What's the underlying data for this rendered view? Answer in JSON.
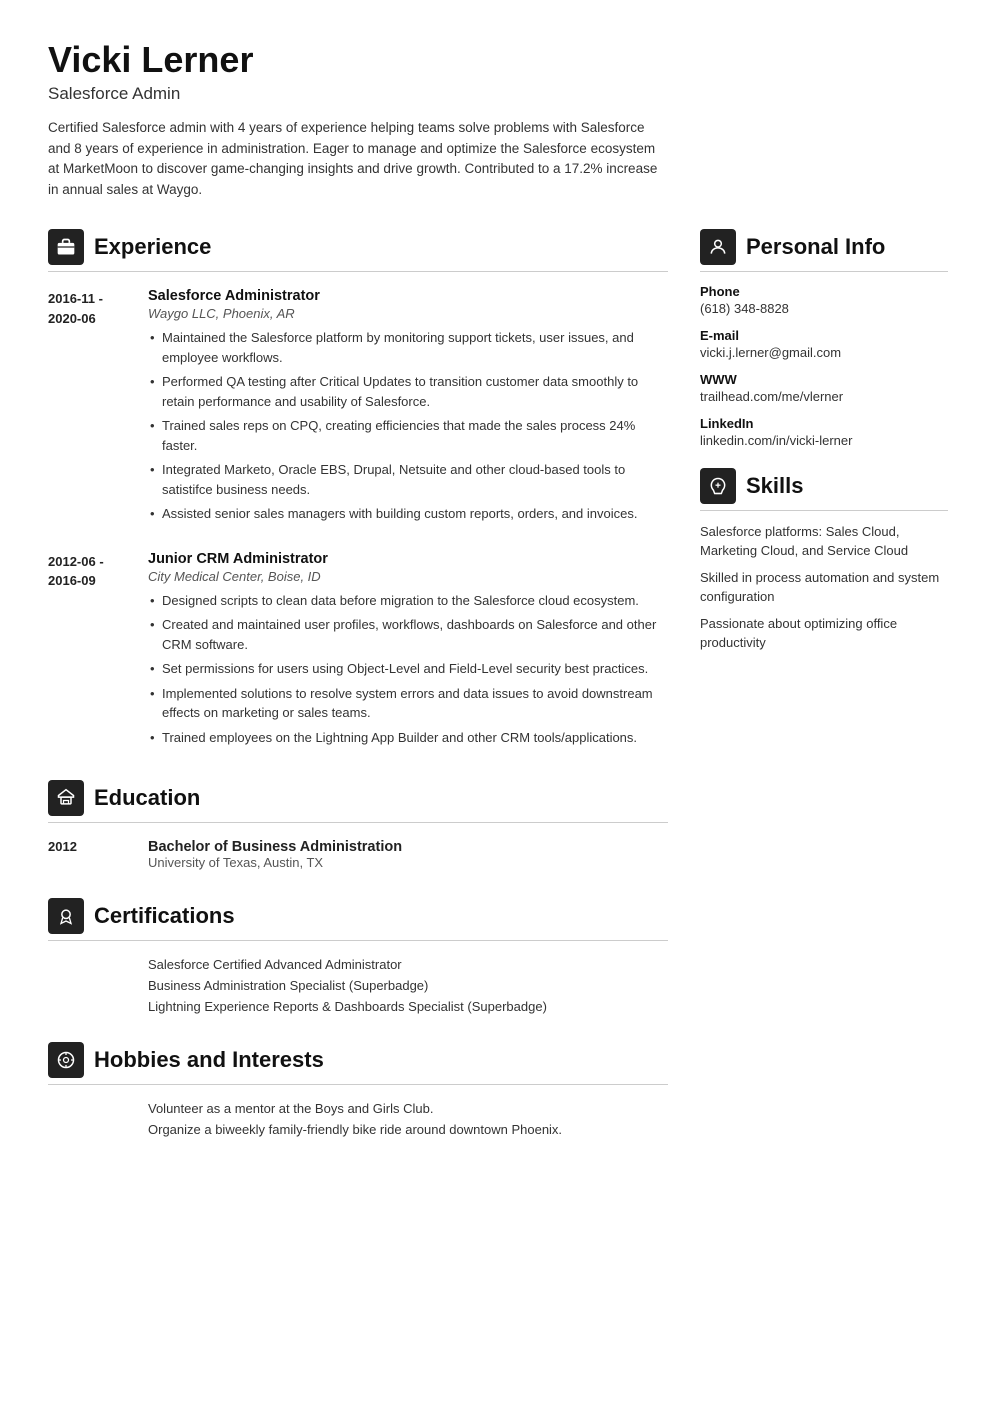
{
  "header": {
    "name": "Vicki Lerner",
    "title": "Salesforce Admin",
    "summary": "Certified Salesforce admin with 4 years of experience helping teams solve problems with Salesforce and 8 years of experience in administration. Eager to manage and optimize the Salesforce ecosystem at MarketMoon to discover game-changing insights and drive growth. Contributed to a 17.2% increase in annual sales at Waygo."
  },
  "experience": {
    "section_title": "Experience",
    "jobs": [
      {
        "dates": "2016-11 -\n2020-06",
        "title": "Salesforce Administrator",
        "company": "Waygo LLC, Phoenix, AR",
        "bullets": [
          "Maintained the Salesforce platform by monitoring support tickets, user issues, and employee workflows.",
          "Performed QA testing after Critical Updates to transition customer data smoothly to retain performance and usability of Salesforce.",
          "Trained sales reps on CPQ, creating efficiencies that made the sales process 24% faster.",
          "Integrated Marketo, Oracle EBS, Drupal, Netsuite and other cloud-based tools to satistifce business needs.",
          "Assisted senior sales managers with building custom reports, orders, and invoices."
        ]
      },
      {
        "dates": "2012-06 -\n2016-09",
        "title": "Junior CRM Administrator",
        "company": "City Medical Center, Boise, ID",
        "bullets": [
          "Designed scripts to clean data before migration to the Salesforce cloud ecosystem.",
          "Created and maintained user profiles, workflows, dashboards on Salesforce and other CRM software.",
          "Set permissions for users using Object-Level and Field-Level security best practices.",
          "Implemented solutions to resolve system errors and data issues to avoid downstream effects on marketing or sales teams.",
          "Trained employees on the Lightning App Builder and other CRM tools/applications."
        ]
      }
    ]
  },
  "education": {
    "section_title": "Education",
    "entries": [
      {
        "year": "2012",
        "degree": "Bachelor of Business Administration",
        "school": "University of Texas, Austin, TX"
      }
    ]
  },
  "certifications": {
    "section_title": "Certifications",
    "items": [
      "Salesforce Certified Advanced Administrator",
      "Business Administration Specialist (Superbadge)",
      "Lightning Experience Reports & Dashboards Specialist (Superbadge)"
    ]
  },
  "hobbies": {
    "section_title": "Hobbies and Interests",
    "items": [
      "Volunteer as a mentor at the Boys and Girls Club.",
      "Organize a biweekly family-friendly bike ride around downtown Phoenix."
    ]
  },
  "personal_info": {
    "section_title": "Personal Info",
    "fields": [
      {
        "label": "Phone",
        "value": "(618) 348-8828"
      },
      {
        "label": "E-mail",
        "value": "vicki.j.lerner@gmail.com"
      },
      {
        "label": "WWW",
        "value": "trailhead.com/me/vlerner"
      },
      {
        "label": "LinkedIn",
        "value": "linkedin.com/in/vicki-lerner"
      }
    ]
  },
  "skills": {
    "section_title": "Skills",
    "items": [
      "Salesforce platforms: Sales Cloud, Marketing Cloud, and Service Cloud",
      "Skilled in process automation and system configuration",
      "Passionate about optimizing office productivity"
    ]
  }
}
